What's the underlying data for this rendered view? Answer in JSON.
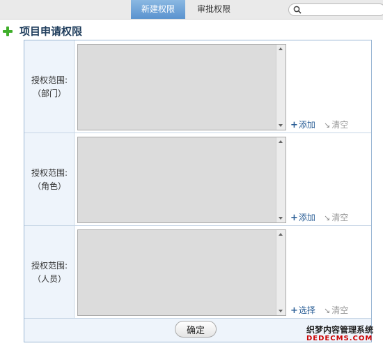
{
  "tabs": [
    {
      "label": "新建权限",
      "active": true
    },
    {
      "label": "审批权限",
      "active": false
    }
  ],
  "search": {
    "placeholder": "",
    "icon": "search-icon"
  },
  "heading": {
    "icon": "plus-icon",
    "title": "项目申请权限",
    "icon_color": "#3fae2a"
  },
  "form": {
    "rows": [
      {
        "label_line1": "授权范围:",
        "label_line2": "（部门）",
        "add_label": "添加",
        "clear_label": "清空"
      },
      {
        "label_line1": "授权范围:",
        "label_line2": "（角色）",
        "add_label": "添加",
        "clear_label": "清空"
      },
      {
        "label_line1": "授权范围:",
        "label_line2": "（人员）",
        "add_label": "选择",
        "clear_label": "清空"
      }
    ],
    "add_symbol": "+",
    "clear_symbol": "↘",
    "confirm_label": "确定"
  },
  "watermark": {
    "line1": "织梦内容管理系统",
    "line2": "DEDECMS.COM"
  },
  "colors": {
    "accent": "#5a93cf",
    "link": "#2a5e96",
    "label_bg": "#eef4fb",
    "border": "#9bb7d4"
  }
}
